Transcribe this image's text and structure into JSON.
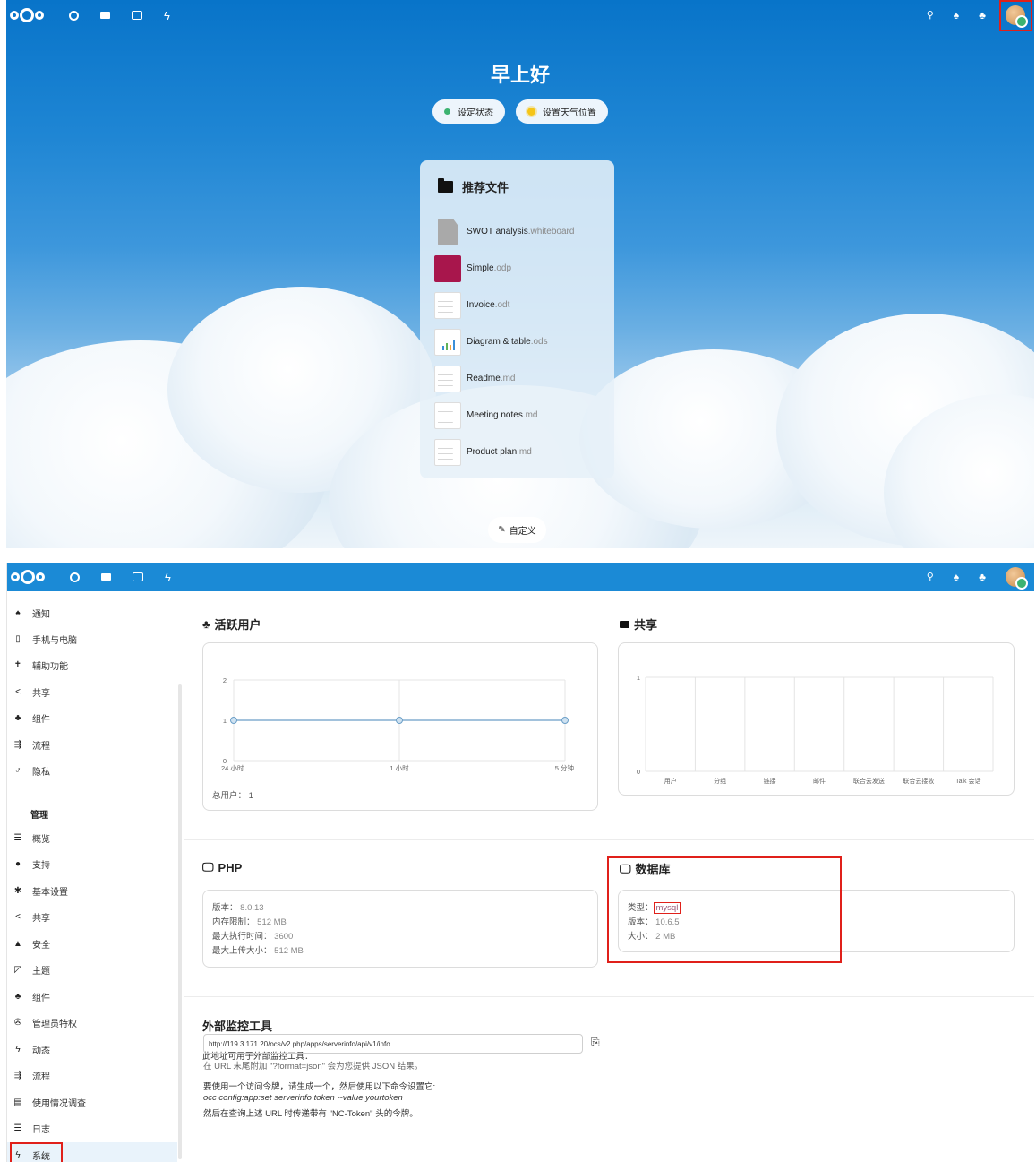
{
  "dashboard": {
    "greeting": "早上好",
    "set_status_label": "设定状态",
    "set_weather_label": "设置天气位置",
    "recommended_title": "推荐文件",
    "files": [
      {
        "name": "SWOT analysis",
        "ext": ".whiteboard"
      },
      {
        "name": "Simple",
        "ext": ".odp"
      },
      {
        "name": "Invoice",
        "ext": ".odt"
      },
      {
        "name": "Diagram & table",
        "ext": ".ods"
      },
      {
        "name": "Readme",
        "ext": ".md"
      },
      {
        "name": "Meeting notes",
        "ext": ".md"
      },
      {
        "name": "Product plan",
        "ext": ".md"
      }
    ],
    "customize_label": "自定义"
  },
  "sidebar": {
    "personal_items": [
      {
        "label": "通知",
        "icon": "bell-icon",
        "glyph": "♠"
      },
      {
        "label": "手机与电脑",
        "icon": "phone-icon",
        "glyph": "▯"
      },
      {
        "label": "辅助功能",
        "icon": "accessibility-icon",
        "glyph": "✝"
      },
      {
        "label": "共享",
        "icon": "share-icon",
        "glyph": "<"
      },
      {
        "label": "组件",
        "icon": "integration-icon",
        "glyph": "♣"
      },
      {
        "label": "流程",
        "icon": "flow-icon",
        "glyph": "⇶"
      },
      {
        "label": "隐私",
        "icon": "privacy-icon",
        "glyph": "♂"
      }
    ],
    "admin_heading": "管理",
    "admin_items": [
      {
        "label": "概览",
        "icon": "overview-icon",
        "glyph": "☰"
      },
      {
        "label": "支持",
        "icon": "support-icon",
        "glyph": "●"
      },
      {
        "label": "基本设置",
        "icon": "settings-icon",
        "glyph": "✱"
      },
      {
        "label": "共享",
        "icon": "share-icon",
        "glyph": "<"
      },
      {
        "label": "安全",
        "icon": "lock-icon",
        "glyph": "▲"
      },
      {
        "label": "主题",
        "icon": "theming-icon",
        "glyph": "◸"
      },
      {
        "label": "组件",
        "icon": "integration-icon",
        "glyph": "♣"
      },
      {
        "label": "管理员特权",
        "icon": "admin-icon",
        "glyph": "✇"
      },
      {
        "label": "动态",
        "icon": "activity-icon",
        "glyph": "ϟ"
      },
      {
        "label": "流程",
        "icon": "flow-icon",
        "glyph": "⇶"
      },
      {
        "label": "使用情况调查",
        "icon": "survey-icon",
        "glyph": "▤"
      },
      {
        "label": "日志",
        "icon": "log-icon",
        "glyph": "☰"
      },
      {
        "label": "系统",
        "icon": "system-icon",
        "glyph": "ϟ"
      }
    ]
  },
  "system": {
    "active_users_title": "活跃用户",
    "shares_title": "共享",
    "active_users_chart": {
      "y_ticks": [
        "2",
        "1",
        "0"
      ],
      "x_labels": [
        "24 小时",
        "1 小时",
        "5 分钟"
      ],
      "total_label": "总用户：",
      "total_value": "1"
    },
    "shares_chart": {
      "y_ticks": [
        "1",
        "0"
      ],
      "x_labels": [
        "用户",
        "分组",
        "链接",
        "邮件",
        "联合云发送",
        "联合云接收",
        "Talk 会话"
      ]
    },
    "php_title": "PHP",
    "php": [
      {
        "label": "版本：",
        "value": "8.0.13"
      },
      {
        "label": "内存限制：",
        "value": "512 MB"
      },
      {
        "label": "最大执行时间：",
        "value": "3600"
      },
      {
        "label": "最大上传大小：",
        "value": "512 MB"
      }
    ],
    "db_title": "数据库",
    "db": [
      {
        "label": "类型：",
        "value": "mysql"
      },
      {
        "label": "版本：",
        "value": "10.6.5"
      },
      {
        "label": "大小：",
        "value": "2 MB"
      }
    ],
    "monitor_title": "外部监控工具",
    "monitor_desc": "此地址可用于外部监控工具：",
    "monitor_url": "http://119.3.171.20/ocs/v2.php/apps/serverinfo/api/v1/info",
    "json_hint": "在 URL 末尾附加 \"?format=json\" 会为您提供 JSON 结果。",
    "token_intro": "要使用一个访问令牌，请生成一个，然后使用以下命令设置它:",
    "token_cmd": "occ config:app:set serverinfo token --value yourtoken",
    "token_header": "然后在查询上述 URL 时传递带有 \"NC-Token\" 头的令牌。"
  },
  "chart_data": [
    {
      "type": "line",
      "categories": [
        "24 小时",
        "1 小时",
        "5 分钟"
      ],
      "values": [
        1,
        1,
        1
      ],
      "ylim": [
        0,
        2
      ]
    },
    {
      "type": "bar",
      "categories": [
        "用户",
        "分组",
        "链接",
        "邮件",
        "联合云发送",
        "联合云接收",
        "Talk 会话"
      ],
      "values": [
        0,
        0,
        0,
        0,
        0,
        0,
        0
      ],
      "ylim": [
        0,
        1
      ]
    }
  ],
  "colors": {
    "header_blue": "#1b8ad6",
    "highlight_red": "#e0201a",
    "status_green": "#3cb371",
    "line_series": "#6a9ec7"
  }
}
